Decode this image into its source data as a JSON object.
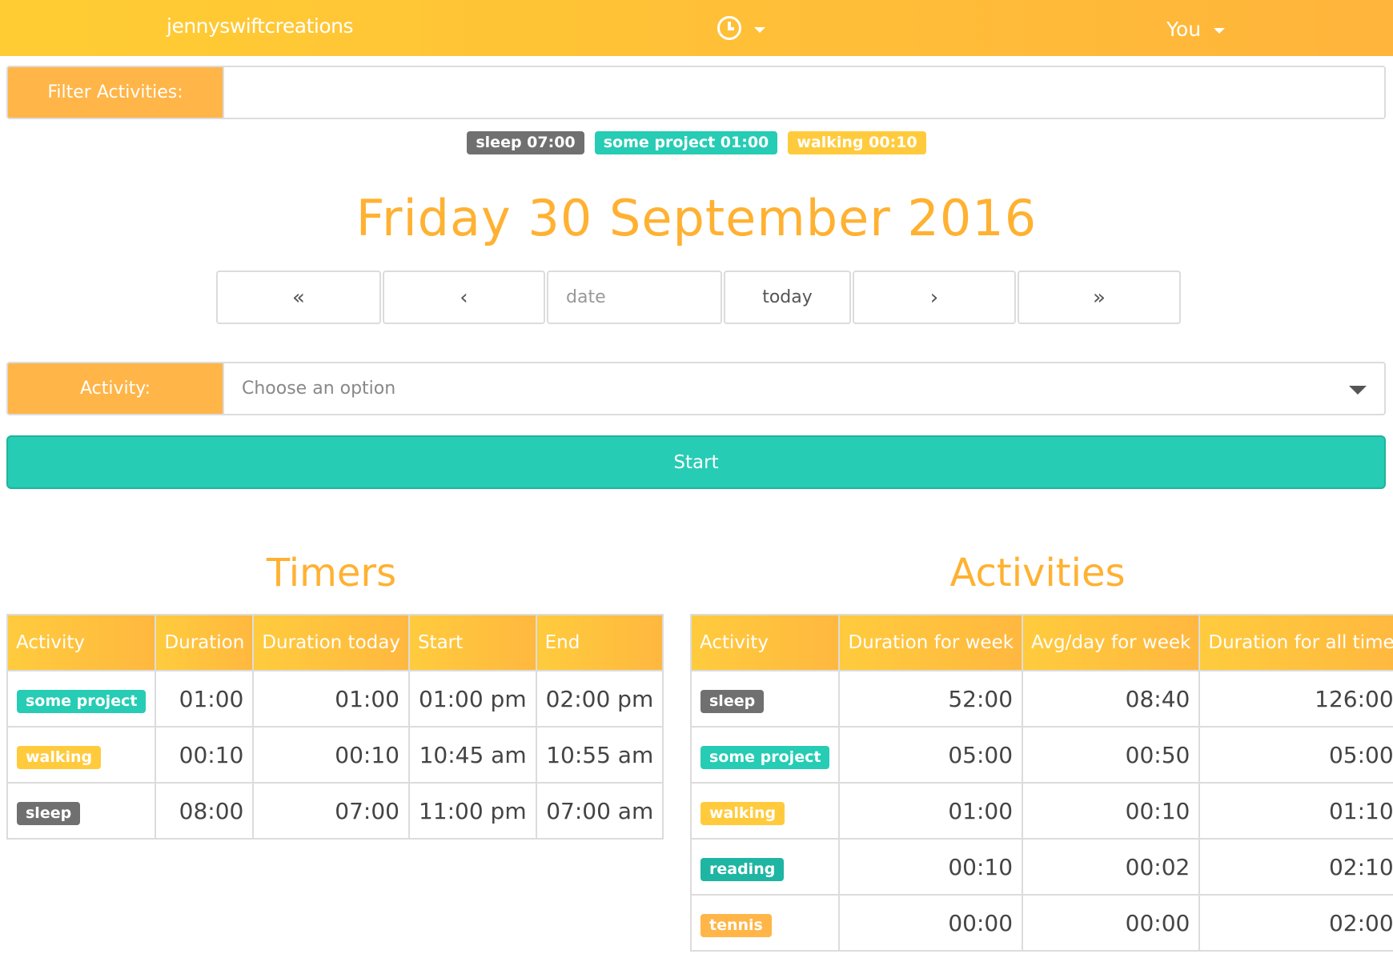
{
  "navbar": {
    "brand": "jennyswiftcreations",
    "clock_menu_icon": "clock-icon",
    "user_label": "You"
  },
  "filter": {
    "label": "Filter Activities:",
    "value": "",
    "placeholder": ""
  },
  "summary_tags": [
    {
      "text": "sleep 07:00",
      "color": "#707070"
    },
    {
      "text": "some project 01:00",
      "color": "#26ccb4"
    },
    {
      "text": "walking 00:10",
      "color": "#ffcb3d"
    }
  ],
  "date_title": "Friday 30 September 2016",
  "date_nav": {
    "prev_week": "«",
    "prev_day": "‹",
    "date_placeholder": "date",
    "today": "today",
    "next_day": "›",
    "next_week": "»"
  },
  "activity_select": {
    "label": "Activity:",
    "selected": "Choose an option"
  },
  "start_button": "Start",
  "timers": {
    "title": "Timers",
    "headers": [
      "Activity",
      "Duration",
      "Duration today",
      "Start",
      "End"
    ],
    "rows": [
      {
        "activity": "some project",
        "duration": "01:00",
        "duration_today": "01:00",
        "start": "01:00 pm",
        "end": "02:00 pm"
      },
      {
        "activity": "walking",
        "duration": "00:10",
        "duration_today": "00:10",
        "start": "10:45 am",
        "end": "10:55 am"
      },
      {
        "activity": "sleep",
        "duration": "08:00",
        "duration_today": "07:00",
        "start": "11:00 pm",
        "end": "07:00 am"
      }
    ]
  },
  "activities": {
    "title": "Activities",
    "headers": [
      "Activity",
      "Duration for week",
      "Avg/day for week",
      "Duration for all time"
    ],
    "rows": [
      {
        "activity": "sleep",
        "week": "52:00",
        "avg": "08:40",
        "all_time": "126:00"
      },
      {
        "activity": "some project",
        "week": "05:00",
        "avg": "00:50",
        "all_time": "05:00"
      },
      {
        "activity": "walking",
        "week": "01:00",
        "avg": "00:10",
        "all_time": "01:10"
      },
      {
        "activity": "reading",
        "week": "00:10",
        "avg": "00:02",
        "all_time": "02:10"
      },
      {
        "activity": "tennis",
        "week": "00:00",
        "avg": "00:00",
        "all_time": "02:00"
      }
    ]
  },
  "colors": {
    "accent_orange": "#ffb547",
    "accent_yellow": "#ffcb3d",
    "teal": "#26ccb4",
    "grey": "#707070",
    "dark_teal": "#1eb5a3"
  }
}
